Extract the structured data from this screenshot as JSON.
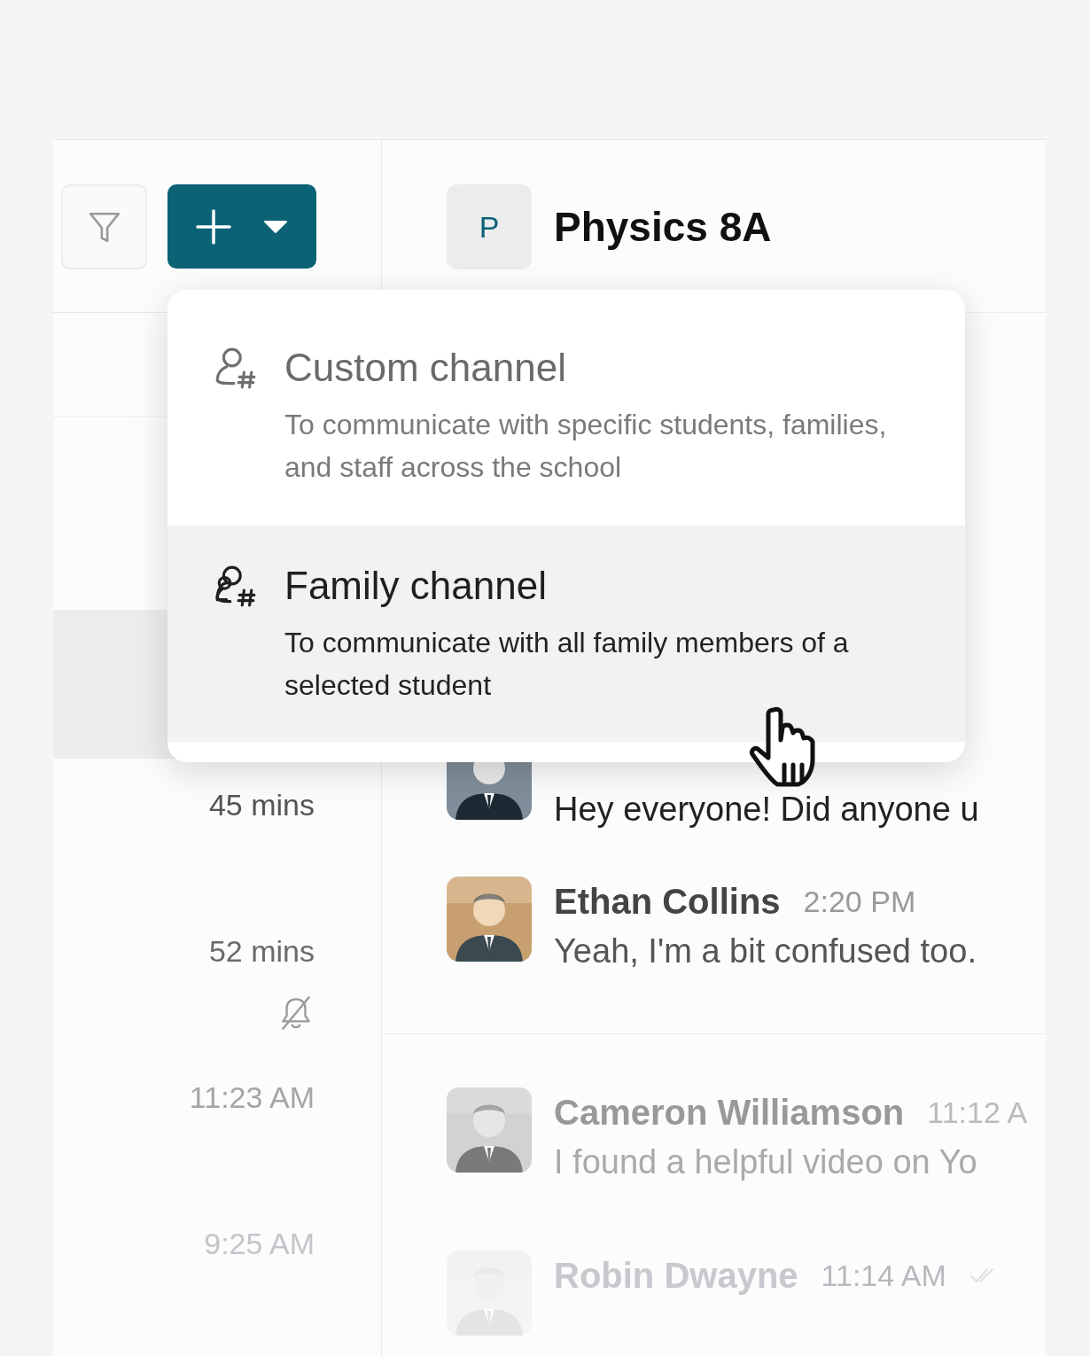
{
  "channel": {
    "initial": "P",
    "title": "Physics 8A"
  },
  "new_menu": {
    "items": [
      {
        "kind": "single",
        "title": "Custom channel",
        "description": "To communicate with specific students, families, and staff across the school",
        "selected": false
      },
      {
        "kind": "family",
        "title": "Family channel",
        "description": "To communicate with all family members of a selected student",
        "selected": true
      }
    ]
  },
  "chats": [
    {
      "time": "45 mins",
      "muted": false
    },
    {
      "time": "52 mins",
      "muted": true
    },
    {
      "time": "11:23 AM",
      "muted": false
    },
    {
      "time": "9:25 AM",
      "muted": false
    }
  ],
  "messages": [
    {
      "text": "Hey everyone! Did anyone u"
    },
    {
      "name": "Ethan Collins",
      "time": "2:20 PM",
      "text": "Yeah, I'm a bit confused too."
    },
    {
      "name": "Cameron Williamson",
      "time": "11:12 A",
      "text": "I found a helpful video on Yo"
    },
    {
      "name": "Robin Dwayne",
      "time": "11:14 AM",
      "read": true
    }
  ]
}
